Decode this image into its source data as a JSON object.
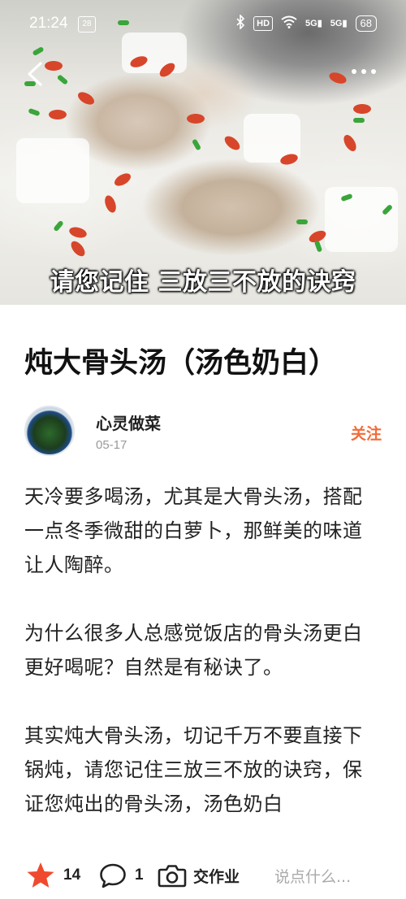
{
  "status_bar": {
    "time": "21:24",
    "notification_badge": "28",
    "hd_label": "HD",
    "signal_1": "5G",
    "signal_2": "5G",
    "battery": "68"
  },
  "hero": {
    "caption": "请您记住 三放三不放的诀窍",
    "icons": [
      "back-arrow-icon",
      "more-dots-icon"
    ]
  },
  "article": {
    "title": "炖大骨头汤（汤色奶白）",
    "author": {
      "name": "心灵做菜",
      "date": "05-17",
      "follow_label": "关注"
    },
    "paragraphs": [
      "天冷要多喝汤，尤其是大骨头汤，搭配一点冬季微甜的白萝卜，那鲜美的味道让人陶醉。",
      "为什么很多人总感觉饭店的骨头汤更白更好喝呢？自然是有秘诀了。",
      "其实炖大骨头汤，切记千万不要直接下锅炖，请您记住三放三不放的诀窍，保证您炖出的骨头汤，汤色奶白"
    ]
  },
  "bottom_bar": {
    "star_count": "14",
    "comment_count": "1",
    "homework_label": "交作业",
    "comment_placeholder": "说点什么...",
    "colors": {
      "star": "#f04a2e",
      "follow": "#f26b3a"
    }
  }
}
